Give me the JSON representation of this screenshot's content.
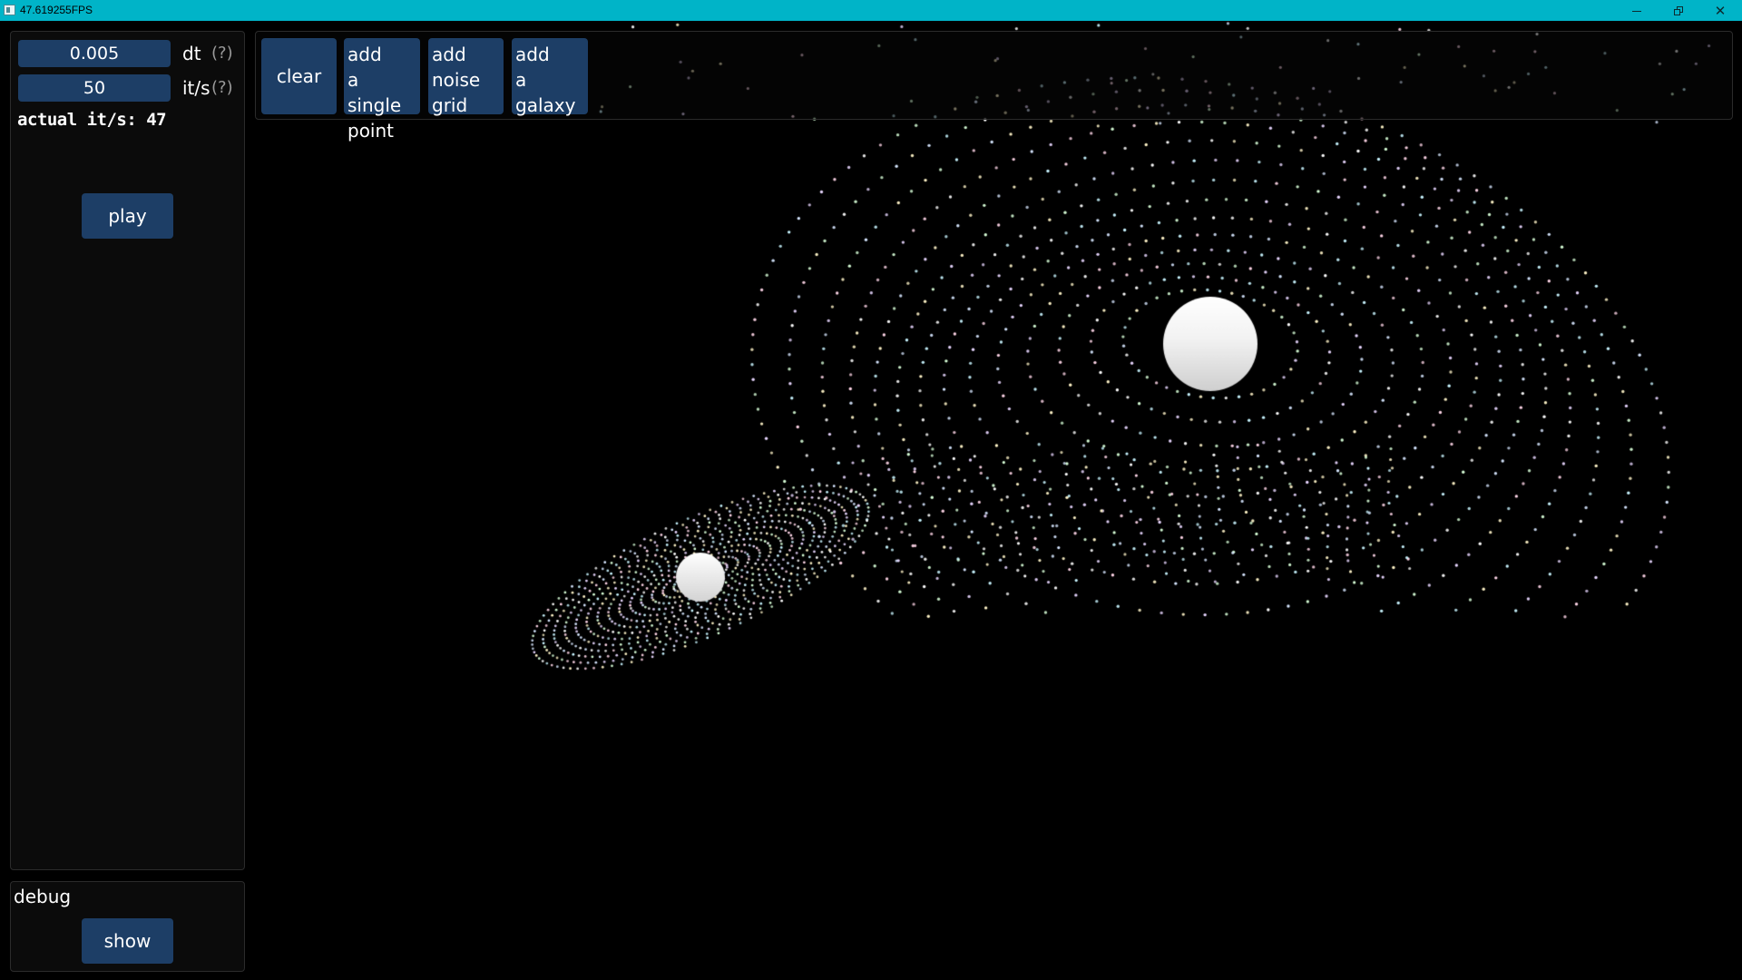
{
  "window": {
    "title": "47.619255FPS",
    "minimize_icon": "minimize-icon",
    "maximize_icon": "restore-icon",
    "close_label": "✕"
  },
  "controls": {
    "dt_value": "0.005",
    "dt_label": "dt",
    "dt_help": "(?)",
    "its_value": "50",
    "its_label": "it/s",
    "its_help": "(?)",
    "actual_its": "actual it/s: 47",
    "play_label": "play"
  },
  "toolbar": {
    "clear_label": "clear",
    "add_single_point_label": "add\na single\npoint",
    "add_noise_grid_label": "add\nnoise\ngrid",
    "add_galaxy_label": "add\na\ngalaxy"
  },
  "debug": {
    "title": "debug",
    "show_label": "show"
  },
  "colors": {
    "titlebar": "#00b4c8",
    "button": "#1d3e66",
    "panel": "#0c0c0c",
    "background": "#000000",
    "particle_palette": [
      "#ffffff",
      "#ffd6e8",
      "#d8ffd8",
      "#d6e6ff",
      "#fff4c8",
      "#e8d6ff",
      "#c8f4ff"
    ]
  }
}
